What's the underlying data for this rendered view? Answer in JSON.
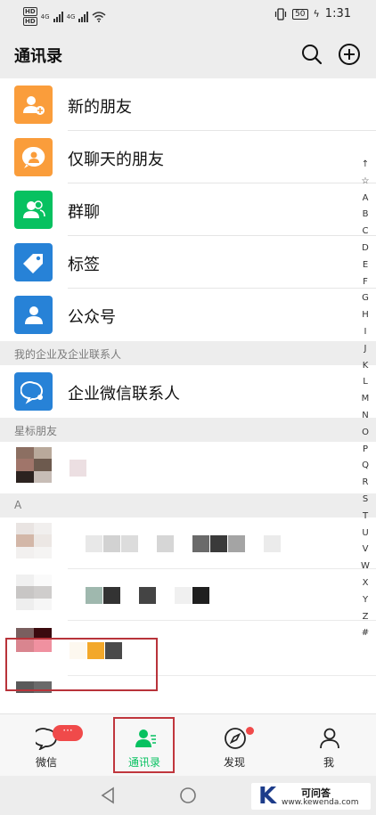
{
  "status_bar": {
    "left_texts": [
      "HD",
      "4G",
      "HD",
      "4G"
    ],
    "battery": "50",
    "time": "1:31"
  },
  "header": {
    "title": "通讯录",
    "search_icon": "search-icon",
    "add_icon": "plus-circle-icon"
  },
  "function_items": [
    {
      "label": "新的朋友",
      "icon": "add-friend-icon",
      "color": "#fa9d3b"
    },
    {
      "label": "仅聊天的朋友",
      "icon": "chat-only-icon",
      "color": "#fa9d3b"
    },
    {
      "label": "群聊",
      "icon": "group-icon",
      "color": "#07c160"
    },
    {
      "label": "标签",
      "icon": "tag-icon",
      "color": "#2782d7"
    },
    {
      "label": "公众号",
      "icon": "official-account-icon",
      "color": "#2782d7"
    }
  ],
  "sections": {
    "enterprise_header": "我的企业及企业联系人",
    "enterprise_item": {
      "label": "企业微信联系人",
      "icon": "work-wechat-icon",
      "color": "#2782d7"
    },
    "starred_header": "星标朋友",
    "a_header": "A"
  },
  "index_letters": [
    "↑",
    "☆",
    "A",
    "B",
    "C",
    "D",
    "E",
    "F",
    "G",
    "H",
    "I",
    "J",
    "K",
    "L",
    "M",
    "N",
    "O",
    "P",
    "Q",
    "R",
    "S",
    "T",
    "U",
    "V",
    "W",
    "X",
    "Y",
    "Z",
    "#"
  ],
  "tabs": [
    {
      "label": "微信",
      "icon": "chat-bubble-icon",
      "badge": "···"
    },
    {
      "label": "通讯录",
      "icon": "contacts-icon",
      "active": true
    },
    {
      "label": "发现",
      "icon": "compass-icon"
    },
    {
      "label": "我",
      "icon": "person-icon"
    }
  ],
  "watermark": {
    "letter": "K",
    "title": "可问答",
    "url": "www.kewenda.com"
  },
  "colors": {
    "accent": "#07c160",
    "highlight_border": "#b8333a",
    "badge": "#f04a4a"
  }
}
